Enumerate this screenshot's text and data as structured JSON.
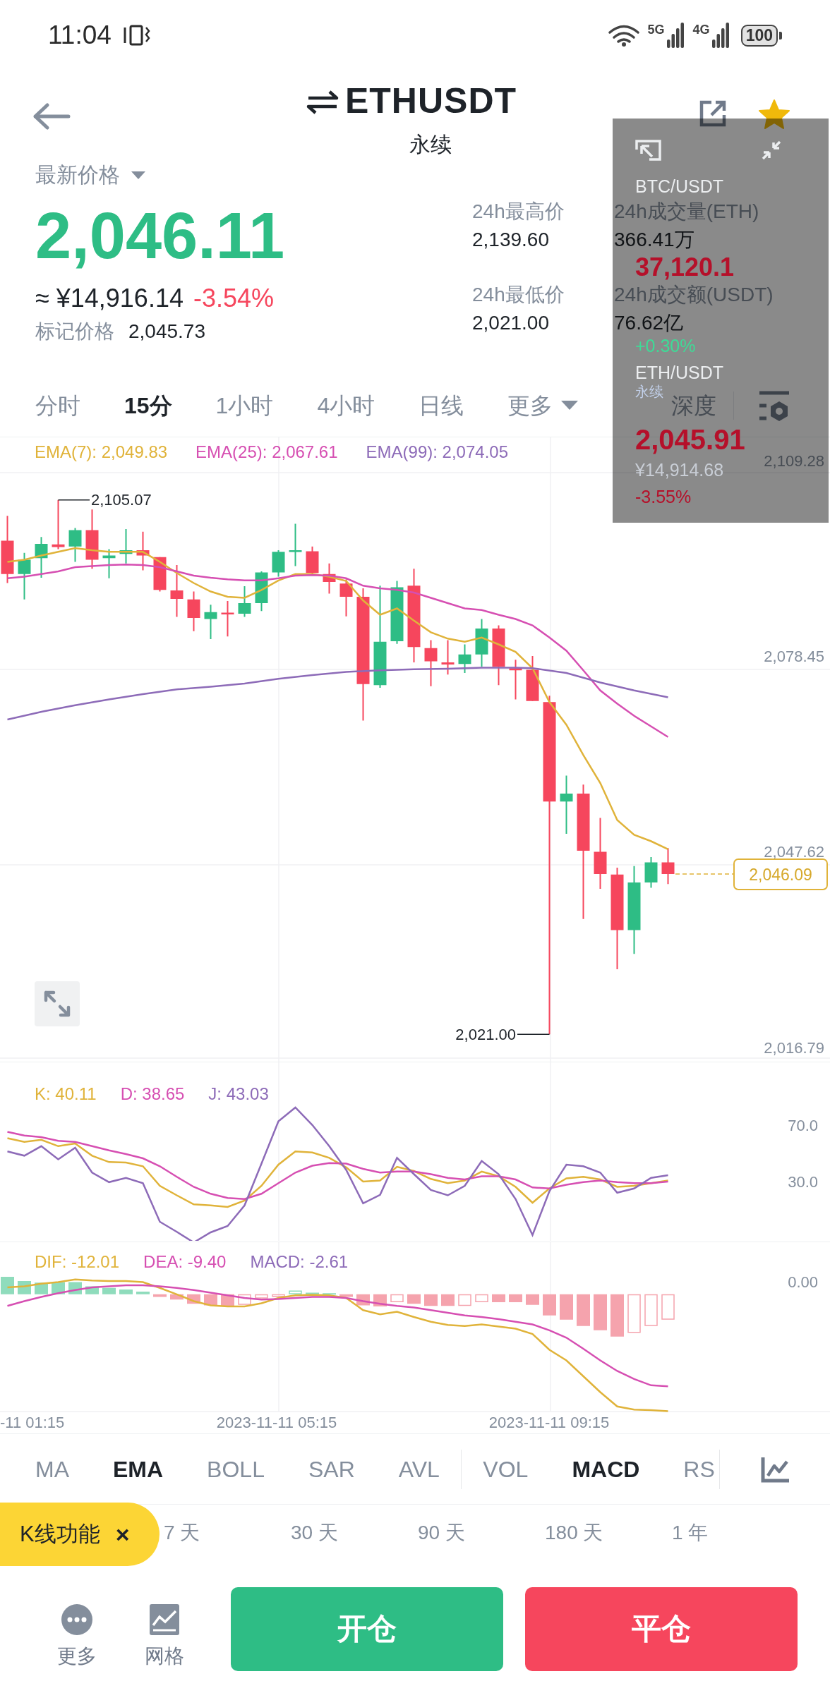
{
  "status_bar": {
    "time": "11:04",
    "networks": [
      "5G",
      "4G"
    ],
    "battery": "100"
  },
  "header": {
    "symbol": "ETHUSDT",
    "contract": "永续",
    "favorite": true
  },
  "price": {
    "label": "最新价格",
    "last": "2,046.11",
    "fiat": "≈ ¥14,916.14",
    "change": "-3.54%",
    "mark_label": "标记价格",
    "mark": "2,045.73"
  },
  "stats": [
    {
      "label": "24h最高价",
      "value": "2,139.60"
    },
    {
      "label": "24h成交量(ETH)",
      "value": "366.41万"
    },
    {
      "label": "24h最低价",
      "value": "2,021.00"
    },
    {
      "label": "24h成交额(USDT)",
      "value": "76.62亿"
    }
  ],
  "intervals": [
    {
      "label": "分时",
      "selected": false
    },
    {
      "label": "15分",
      "selected": true
    },
    {
      "label": "1小时",
      "selected": false
    },
    {
      "label": "4小时",
      "selected": false
    },
    {
      "label": "日线",
      "selected": false
    }
  ],
  "more": "更多",
  "depth": "深度",
  "chart": {
    "legend": [
      {
        "label": "EMA(7): 2,049.83",
        "color": "#e0b33a"
      },
      {
        "label": "EMA(25): 2,067.61",
        "color": "#d64fb2"
      },
      {
        "label": "EMA(99): 2,074.05",
        "color": "#8d6bb8"
      }
    ],
    "y_labels": [
      "2,109.28",
      "2,078.45",
      "2,047.62",
      "2,016.79"
    ],
    "high_label": "2,105.07",
    "low_label": "2,021.00",
    "last_price": "2,046.09"
  },
  "kdj": {
    "legend": [
      {
        "label": "K: 40.11",
        "color": "#e0b33a"
      },
      {
        "label": "D: 38.65",
        "color": "#d64fb2"
      },
      {
        "label": "J: 43.03",
        "color": "#8d6bb8"
      }
    ],
    "y_labels": [
      "70.0",
      "30.0"
    ]
  },
  "macd": {
    "legend": [
      {
        "label": "DIF: -12.01",
        "color": "#e0b33a"
      },
      {
        "label": "DEA: -9.40",
        "color": "#d64fb2"
      },
      {
        "label": "MACD: -2.61",
        "color": "#8d6bb8"
      }
    ],
    "y_labels": [
      "0.00"
    ],
    "time_labels": [
      "-11 01:15",
      "2023-11-11 05:15",
      "2023-11-11 09:15"
    ]
  },
  "indicators": {
    "main": [
      {
        "label": "MA",
        "selected": false
      },
      {
        "label": "EMA",
        "selected": true
      },
      {
        "label": "BOLL",
        "selected": false
      },
      {
        "label": "SAR",
        "selected": false
      },
      {
        "label": "AVL",
        "selected": false
      }
    ],
    "sub": [
      {
        "label": "VOL",
        "selected": false
      },
      {
        "label": "MACD",
        "selected": true
      },
      {
        "label": "RS",
        "selected": false
      }
    ]
  },
  "periods": [
    "7 天",
    "30 天",
    "90 天",
    "180 天",
    "1 年"
  ],
  "kline_chip": {
    "label": "K线功能",
    "close": "×"
  },
  "bottom": {
    "tools": [
      {
        "label": "更多",
        "kind": "more"
      },
      {
        "label": "网格",
        "kind": "grid"
      }
    ],
    "actions": [
      {
        "label": "开仓",
        "kind": "open"
      },
      {
        "label": "平仓",
        "kind": "close"
      }
    ]
  },
  "floating_window": {
    "pairs": [
      {
        "symbol": "BTC/USDT",
        "price": "37,120.1",
        "change": "+0.30%",
        "rising": true
      },
      {
        "symbol": "ETH/USDT",
        "contract": "永续",
        "price": "2,045.91",
        "fiat": "¥14,914.68",
        "change": "-3.55%",
        "rising": false
      }
    ]
  }
}
